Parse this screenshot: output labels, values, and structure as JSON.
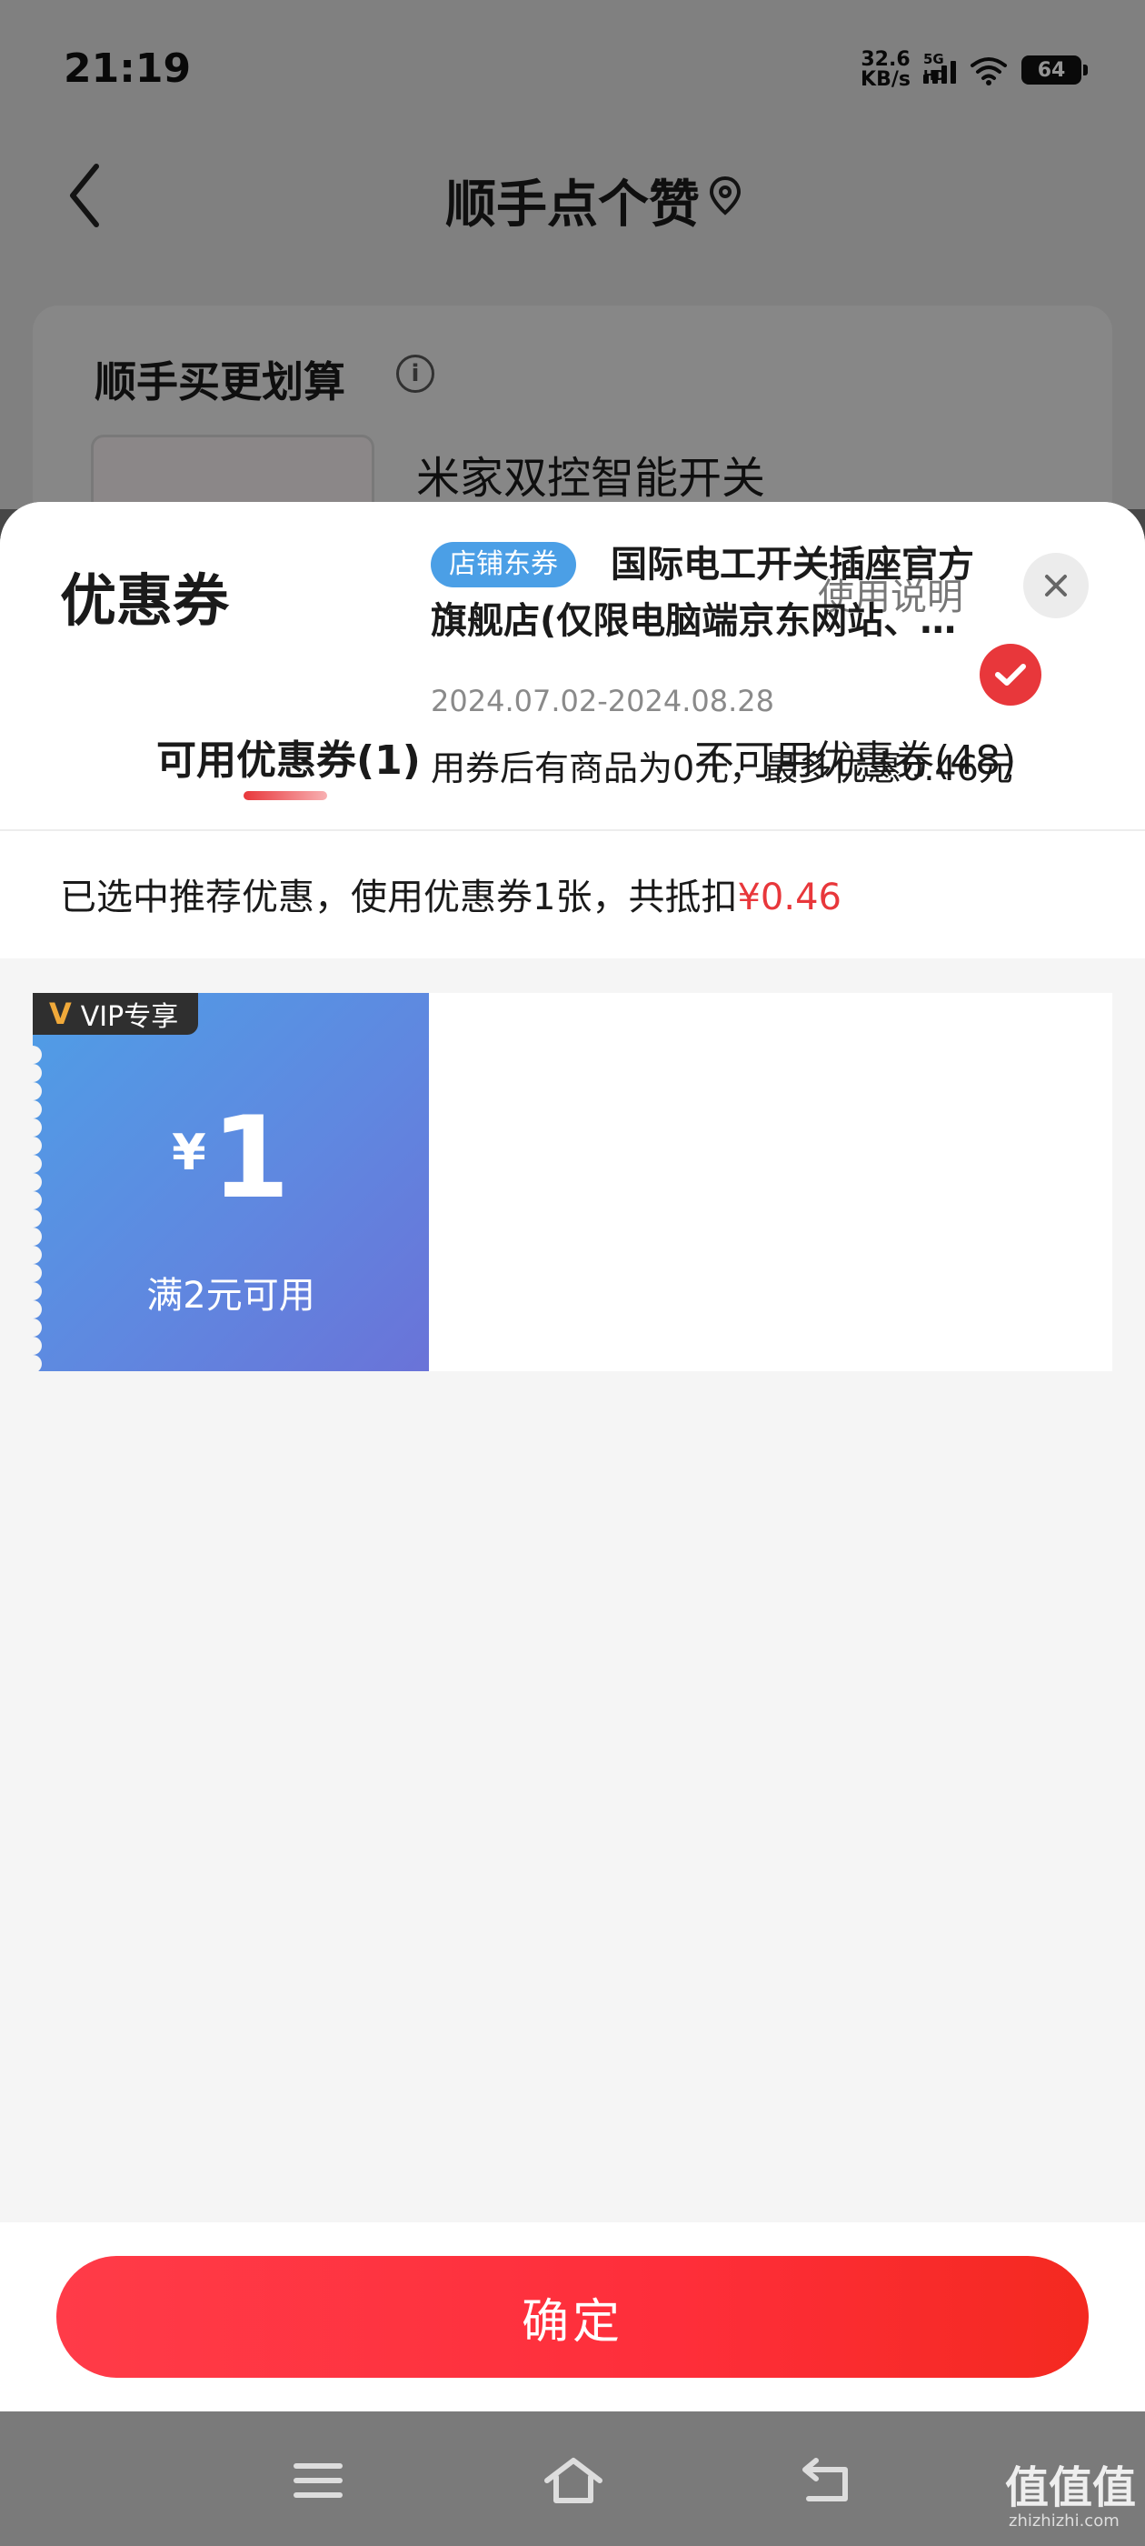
{
  "status_bar": {
    "time": "21:19",
    "net_speed_value": "32.6",
    "net_speed_unit": "KB/s",
    "network_type": "5G HD",
    "battery": "64"
  },
  "background_page": {
    "title": "顺手点个赞",
    "section_title": "顺手买更划算",
    "product_name": "米家双控智能开关"
  },
  "sheet": {
    "title": "优惠券",
    "help_label": "使用说明",
    "tabs": [
      {
        "label": "可用优惠券(1)",
        "active": true
      },
      {
        "label": "不可用优惠券(48)",
        "active": false
      }
    ],
    "summary_prefix": "已选中推荐优惠，使用优惠券1张，共抵扣",
    "summary_amount": "¥0.46",
    "coupons": [
      {
        "vip_tag": "VIP专享",
        "currency": "¥",
        "value": "1",
        "condition": "满2元可用",
        "badge": "店铺东券",
        "shop": "国际电工开关插座官方旗舰店(仅限电脑端京东网站、…",
        "date_range": "2024.07.02-2024.08.28",
        "description": "用券后有商品为0元，最多优惠0.46元",
        "selected": true
      }
    ],
    "confirm_label": "确定"
  },
  "watermark": {
    "text": "值值值",
    "sub": "zhizhizhi.com"
  },
  "colors": {
    "accent_red": "#e8373b",
    "coupon_blue": "#5f88e0",
    "badge_blue": "#4b9fe6"
  }
}
